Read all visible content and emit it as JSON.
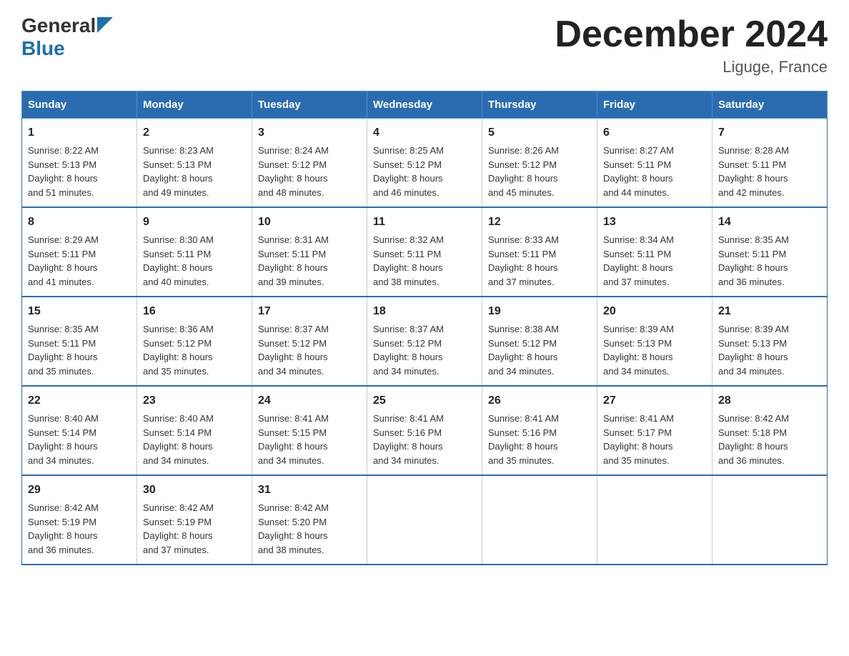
{
  "header": {
    "logo_general": "General",
    "logo_blue": "Blue",
    "title": "December 2024",
    "subtitle": "Liguge, France"
  },
  "days_of_week": [
    "Sunday",
    "Monday",
    "Tuesday",
    "Wednesday",
    "Thursday",
    "Friday",
    "Saturday"
  ],
  "weeks": [
    [
      {
        "day": "1",
        "sunrise": "Sunrise: 8:22 AM",
        "sunset": "Sunset: 5:13 PM",
        "daylight": "Daylight: 8 hours",
        "daylight2": "and 51 minutes."
      },
      {
        "day": "2",
        "sunrise": "Sunrise: 8:23 AM",
        "sunset": "Sunset: 5:13 PM",
        "daylight": "Daylight: 8 hours",
        "daylight2": "and 49 minutes."
      },
      {
        "day": "3",
        "sunrise": "Sunrise: 8:24 AM",
        "sunset": "Sunset: 5:12 PM",
        "daylight": "Daylight: 8 hours",
        "daylight2": "and 48 minutes."
      },
      {
        "day": "4",
        "sunrise": "Sunrise: 8:25 AM",
        "sunset": "Sunset: 5:12 PM",
        "daylight": "Daylight: 8 hours",
        "daylight2": "and 46 minutes."
      },
      {
        "day": "5",
        "sunrise": "Sunrise: 8:26 AM",
        "sunset": "Sunset: 5:12 PM",
        "daylight": "Daylight: 8 hours",
        "daylight2": "and 45 minutes."
      },
      {
        "day": "6",
        "sunrise": "Sunrise: 8:27 AM",
        "sunset": "Sunset: 5:11 PM",
        "daylight": "Daylight: 8 hours",
        "daylight2": "and 44 minutes."
      },
      {
        "day": "7",
        "sunrise": "Sunrise: 8:28 AM",
        "sunset": "Sunset: 5:11 PM",
        "daylight": "Daylight: 8 hours",
        "daylight2": "and 42 minutes."
      }
    ],
    [
      {
        "day": "8",
        "sunrise": "Sunrise: 8:29 AM",
        "sunset": "Sunset: 5:11 PM",
        "daylight": "Daylight: 8 hours",
        "daylight2": "and 41 minutes."
      },
      {
        "day": "9",
        "sunrise": "Sunrise: 8:30 AM",
        "sunset": "Sunset: 5:11 PM",
        "daylight": "Daylight: 8 hours",
        "daylight2": "and 40 minutes."
      },
      {
        "day": "10",
        "sunrise": "Sunrise: 8:31 AM",
        "sunset": "Sunset: 5:11 PM",
        "daylight": "Daylight: 8 hours",
        "daylight2": "and 39 minutes."
      },
      {
        "day": "11",
        "sunrise": "Sunrise: 8:32 AM",
        "sunset": "Sunset: 5:11 PM",
        "daylight": "Daylight: 8 hours",
        "daylight2": "and 38 minutes."
      },
      {
        "day": "12",
        "sunrise": "Sunrise: 8:33 AM",
        "sunset": "Sunset: 5:11 PM",
        "daylight": "Daylight: 8 hours",
        "daylight2": "and 37 minutes."
      },
      {
        "day": "13",
        "sunrise": "Sunrise: 8:34 AM",
        "sunset": "Sunset: 5:11 PM",
        "daylight": "Daylight: 8 hours",
        "daylight2": "and 37 minutes."
      },
      {
        "day": "14",
        "sunrise": "Sunrise: 8:35 AM",
        "sunset": "Sunset: 5:11 PM",
        "daylight": "Daylight: 8 hours",
        "daylight2": "and 36 minutes."
      }
    ],
    [
      {
        "day": "15",
        "sunrise": "Sunrise: 8:35 AM",
        "sunset": "Sunset: 5:11 PM",
        "daylight": "Daylight: 8 hours",
        "daylight2": "and 35 minutes."
      },
      {
        "day": "16",
        "sunrise": "Sunrise: 8:36 AM",
        "sunset": "Sunset: 5:12 PM",
        "daylight": "Daylight: 8 hours",
        "daylight2": "and 35 minutes."
      },
      {
        "day": "17",
        "sunrise": "Sunrise: 8:37 AM",
        "sunset": "Sunset: 5:12 PM",
        "daylight": "Daylight: 8 hours",
        "daylight2": "and 34 minutes."
      },
      {
        "day": "18",
        "sunrise": "Sunrise: 8:37 AM",
        "sunset": "Sunset: 5:12 PM",
        "daylight": "Daylight: 8 hours",
        "daylight2": "and 34 minutes."
      },
      {
        "day": "19",
        "sunrise": "Sunrise: 8:38 AM",
        "sunset": "Sunset: 5:12 PM",
        "daylight": "Daylight: 8 hours",
        "daylight2": "and 34 minutes."
      },
      {
        "day": "20",
        "sunrise": "Sunrise: 8:39 AM",
        "sunset": "Sunset: 5:13 PM",
        "daylight": "Daylight: 8 hours",
        "daylight2": "and 34 minutes."
      },
      {
        "day": "21",
        "sunrise": "Sunrise: 8:39 AM",
        "sunset": "Sunset: 5:13 PM",
        "daylight": "Daylight: 8 hours",
        "daylight2": "and 34 minutes."
      }
    ],
    [
      {
        "day": "22",
        "sunrise": "Sunrise: 8:40 AM",
        "sunset": "Sunset: 5:14 PM",
        "daylight": "Daylight: 8 hours",
        "daylight2": "and 34 minutes."
      },
      {
        "day": "23",
        "sunrise": "Sunrise: 8:40 AM",
        "sunset": "Sunset: 5:14 PM",
        "daylight": "Daylight: 8 hours",
        "daylight2": "and 34 minutes."
      },
      {
        "day": "24",
        "sunrise": "Sunrise: 8:41 AM",
        "sunset": "Sunset: 5:15 PM",
        "daylight": "Daylight: 8 hours",
        "daylight2": "and 34 minutes."
      },
      {
        "day": "25",
        "sunrise": "Sunrise: 8:41 AM",
        "sunset": "Sunset: 5:16 PM",
        "daylight": "Daylight: 8 hours",
        "daylight2": "and 34 minutes."
      },
      {
        "day": "26",
        "sunrise": "Sunrise: 8:41 AM",
        "sunset": "Sunset: 5:16 PM",
        "daylight": "Daylight: 8 hours",
        "daylight2": "and 35 minutes."
      },
      {
        "day": "27",
        "sunrise": "Sunrise: 8:41 AM",
        "sunset": "Sunset: 5:17 PM",
        "daylight": "Daylight: 8 hours",
        "daylight2": "and 35 minutes."
      },
      {
        "day": "28",
        "sunrise": "Sunrise: 8:42 AM",
        "sunset": "Sunset: 5:18 PM",
        "daylight": "Daylight: 8 hours",
        "daylight2": "and 36 minutes."
      }
    ],
    [
      {
        "day": "29",
        "sunrise": "Sunrise: 8:42 AM",
        "sunset": "Sunset: 5:19 PM",
        "daylight": "Daylight: 8 hours",
        "daylight2": "and 36 minutes."
      },
      {
        "day": "30",
        "sunrise": "Sunrise: 8:42 AM",
        "sunset": "Sunset: 5:19 PM",
        "daylight": "Daylight: 8 hours",
        "daylight2": "and 37 minutes."
      },
      {
        "day": "31",
        "sunrise": "Sunrise: 8:42 AM",
        "sunset": "Sunset: 5:20 PM",
        "daylight": "Daylight: 8 hours",
        "daylight2": "and 38 minutes."
      },
      {
        "day": "",
        "sunrise": "",
        "sunset": "",
        "daylight": "",
        "daylight2": ""
      },
      {
        "day": "",
        "sunrise": "",
        "sunset": "",
        "daylight": "",
        "daylight2": ""
      },
      {
        "day": "",
        "sunrise": "",
        "sunset": "",
        "daylight": "",
        "daylight2": ""
      },
      {
        "day": "",
        "sunrise": "",
        "sunset": "",
        "daylight": "",
        "daylight2": ""
      }
    ]
  ]
}
